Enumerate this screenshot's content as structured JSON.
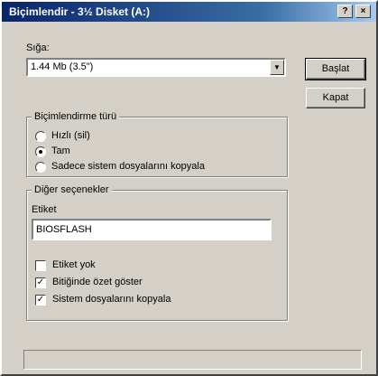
{
  "window": {
    "title": "Biçimlendir - 3½ Disket (A:)",
    "help_label": "?",
    "close_label": "×"
  },
  "capacity": {
    "label": "Sığa:",
    "value": "1.44 Mb (3.5\")",
    "arrow": "▼"
  },
  "buttons": {
    "start": "Başlat",
    "close": "Kapat"
  },
  "format_type": {
    "title": "Biçimlendirme türü",
    "options": [
      {
        "label": "Hızlı (sil)",
        "checked": false
      },
      {
        "label": "Tam",
        "checked": true
      },
      {
        "label": "Sadece sistem dosyalarını kopyala",
        "checked": false
      }
    ]
  },
  "other_options": {
    "title": "Diğer seçenekler",
    "label_caption": "Etiket",
    "label_value": "BIOSFLASH",
    "checkboxes": [
      {
        "label": "Etiket yok",
        "checked": false
      },
      {
        "label": "Bitiğinde özet göster",
        "checked": true
      },
      {
        "label": "Sistem dosyalarını kopyala",
        "checked": true
      }
    ],
    "check_mark": "✓"
  }
}
